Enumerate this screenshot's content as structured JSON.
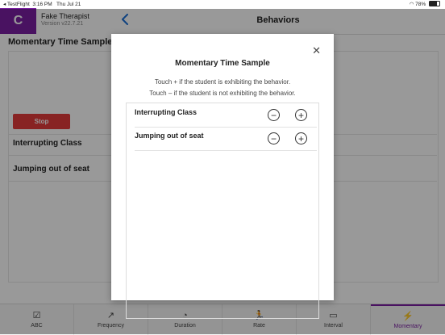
{
  "status_bar": {
    "app": "◂ TestFlight",
    "time": "3:16 PM",
    "date": "Thu Jul 21",
    "battery": "78%"
  },
  "app": {
    "logo": "C",
    "name": "Fake Therapist",
    "version": "Version v22.7.21"
  },
  "nav": {
    "title": "Behaviors"
  },
  "side": {
    "title": "Momentary Time Sample",
    "stop_label": "Stop",
    "behaviors": [
      "Interrupting Class",
      "Jumping out of seat"
    ]
  },
  "tabs": [
    {
      "label": "ABC",
      "icon": "check-square-icon",
      "glyph": "☑"
    },
    {
      "label": "Frequency",
      "icon": "chart-icon",
      "glyph": "↗"
    },
    {
      "label": "Duration",
      "icon": "stopwatch-icon",
      "glyph": "◔"
    },
    {
      "label": "Rate",
      "icon": "runner-icon",
      "glyph": "🏃"
    },
    {
      "label": "Interval",
      "icon": "interval-icon",
      "glyph": "▭"
    },
    {
      "label": "Momentary",
      "icon": "bolt-icon",
      "glyph": "⚡"
    }
  ],
  "active_tab": "Momentary",
  "modal": {
    "title": "Momentary Time Sample",
    "instruction_plus": "Touch + if the student is exhibiting the behavior.",
    "instruction_minus": "Touch – if the student is not exhibiting the behavior.",
    "close_glyph": "✕",
    "minus_glyph": "−",
    "plus_glyph": "+",
    "rows": [
      {
        "label": "Interrupting Class"
      },
      {
        "label": "Jumping out of seat"
      }
    ]
  },
  "colors": {
    "brand": "#7a1fa2",
    "stop": "#e33b3b",
    "link": "#1a6fd6"
  }
}
